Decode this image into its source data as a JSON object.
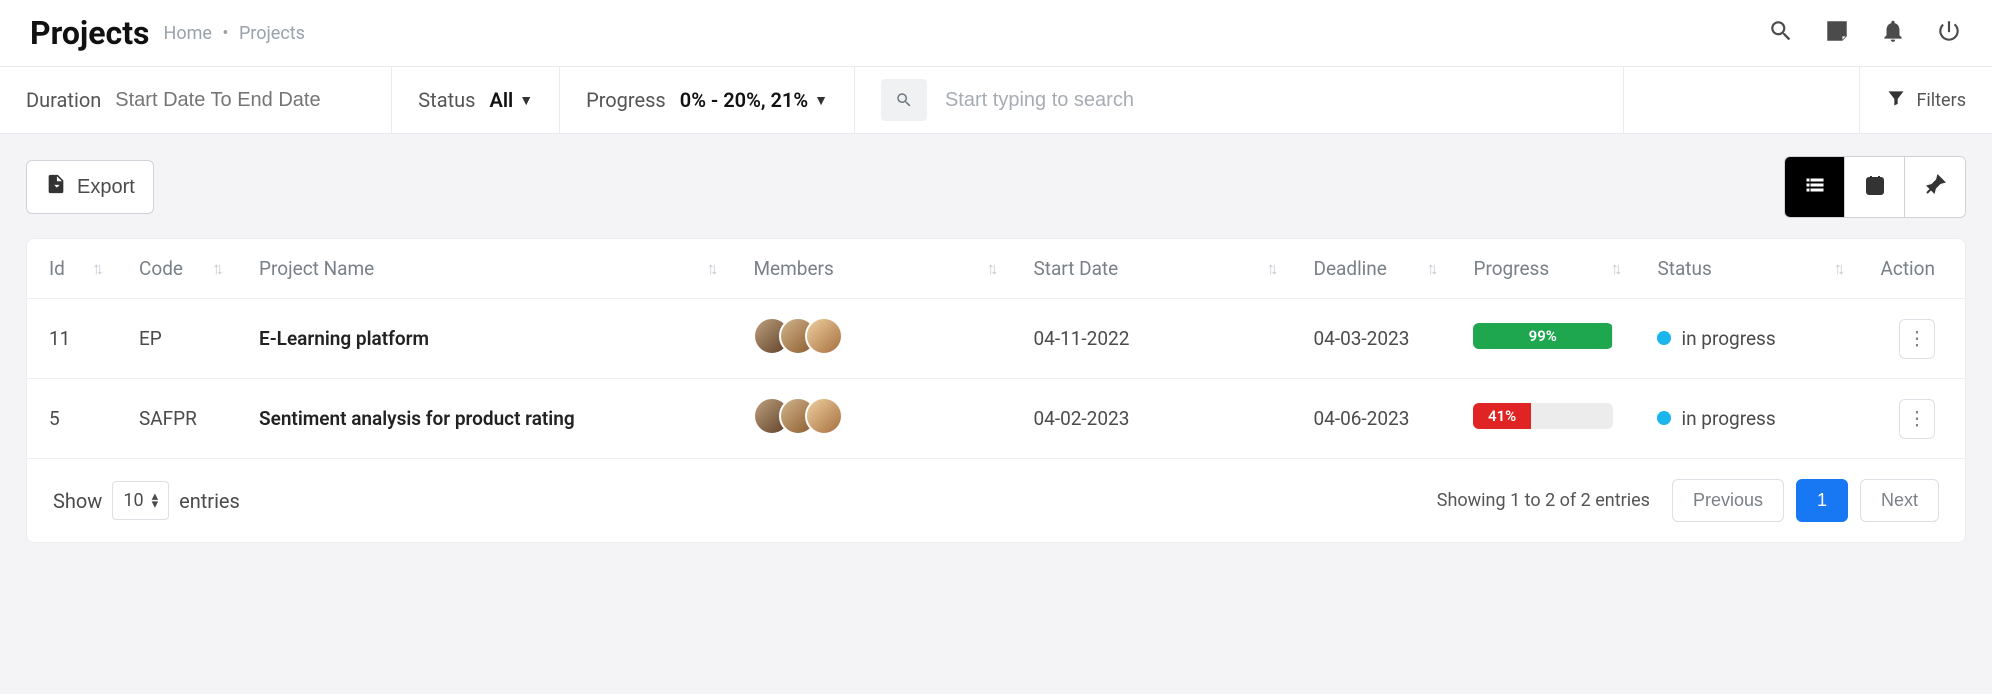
{
  "header": {
    "title": "Projects",
    "breadcrumb": {
      "home": "Home",
      "current": "Projects"
    }
  },
  "filters": {
    "duration_label": "Duration",
    "duration_placeholder": "Start Date To End Date",
    "status_label": "Status",
    "status_value": "All",
    "progress_label": "Progress",
    "progress_value": "0% - 20%, 21%",
    "search_placeholder": "Start typing to search",
    "filters_label": "Filters"
  },
  "toolbar": {
    "export_label": "Export"
  },
  "table": {
    "columns": {
      "id": "Id",
      "code": "Code",
      "project_name": "Project Name",
      "members": "Members",
      "start_date": "Start Date",
      "deadline": "Deadline",
      "progress": "Progress",
      "status": "Status",
      "action": "Action"
    },
    "rows": [
      {
        "id": "11",
        "code": "EP",
        "name": "E-Learning platform",
        "member_count": 3,
        "start_date": "04-11-2022",
        "deadline": "04-03-2023",
        "progress_pct": 99,
        "progress_text": "99%",
        "progress_color": "green",
        "status_text": "in progress",
        "status_color": "#18b6ea"
      },
      {
        "id": "5",
        "code": "SAFPR",
        "name": "Sentiment analysis for product rating",
        "member_count": 3,
        "start_date": "04-02-2023",
        "deadline": "04-06-2023",
        "progress_pct": 41,
        "progress_text": "41%",
        "progress_color": "red",
        "status_text": "in progress",
        "status_color": "#18b6ea"
      }
    ]
  },
  "footer": {
    "show_label": "Show",
    "entries_value": "10",
    "entries_label": "entries",
    "summary": "Showing 1 to 2 of 2 entries",
    "pagination": {
      "prev": "Previous",
      "page": "1",
      "next": "Next"
    }
  }
}
